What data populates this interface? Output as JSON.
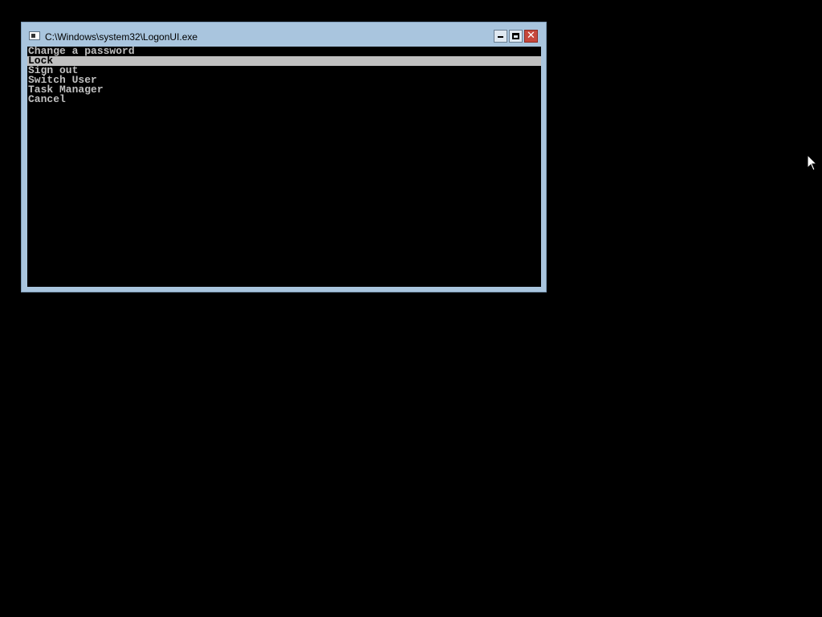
{
  "window": {
    "title": "C:\\Windows\\system32\\LogonUI.exe",
    "controls": {
      "minimize": "minimize",
      "maximize": "maximize",
      "close": "✕"
    }
  },
  "menu": {
    "items": [
      {
        "label": "Change a password",
        "selected": false
      },
      {
        "label": "Lock",
        "selected": true
      },
      {
        "label": "Sign out",
        "selected": false
      },
      {
        "label": "Switch User",
        "selected": false
      },
      {
        "label": "Task Manager",
        "selected": false
      },
      {
        "label": "Cancel",
        "selected": false
      }
    ]
  },
  "colors": {
    "desktop": "#000000",
    "window_frame": "#a9c5de",
    "console_bg": "#000000",
    "console_text": "#c0c0c0",
    "selection_bg": "#c0c0c0",
    "close_button": "#c7483c"
  },
  "icons": {
    "app": "console-window-icon",
    "cursor": "arrow-cursor-icon"
  }
}
